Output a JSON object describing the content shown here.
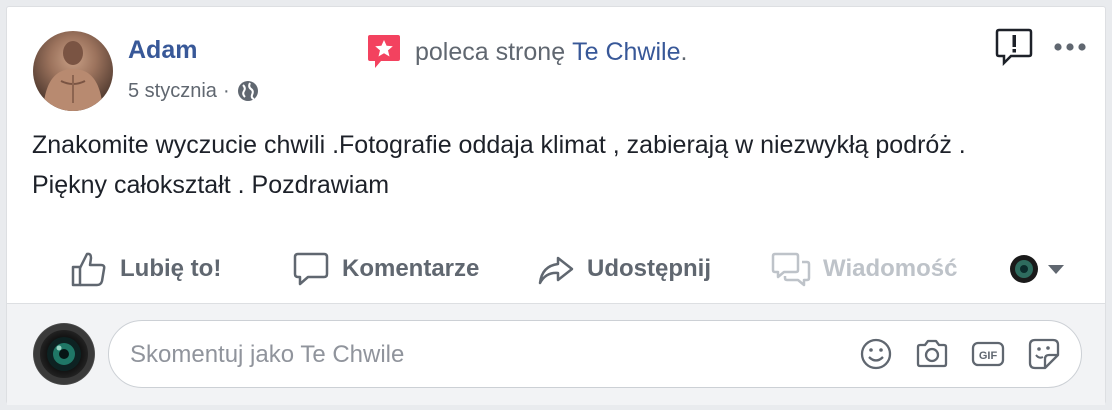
{
  "post": {
    "author_name": "Adam",
    "date": "5 stycznia",
    "separator": "·",
    "recommend_text": "poleca stronę",
    "recommended_page": "Te Chwile",
    "recommend_suffix": ".",
    "body_line1": "Znakomite wyczucie chwili .Fotografie oddaja klimat , zabierają w niezwykłą podróż .",
    "body_line2": "Piękny całokształt . Pozdrawiam"
  },
  "actions": {
    "like": "Lubię to!",
    "comment": "Komentarze",
    "share": "Udostępnij",
    "message": "Wiadomość"
  },
  "comment_box": {
    "placeholder": "Skomentuj jako Te Chwile"
  },
  "icons": {
    "privacy": "globe-icon",
    "recommend": "star-badge-icon",
    "report": "report-icon",
    "more": "more-icon",
    "like": "thumbs-up-icon",
    "comment": "comment-bubble-icon",
    "share": "share-arrow-icon",
    "message": "messenger-icon",
    "emoji": "emoji-icon",
    "camera": "camera-icon",
    "gif": "gif-icon",
    "sticker": "sticker-icon"
  },
  "colors": {
    "link": "#385898",
    "secondary_text": "#606770",
    "body_text": "#1d2129",
    "recommend_badge": "#f3425f",
    "disabled": "#bec3c9"
  }
}
